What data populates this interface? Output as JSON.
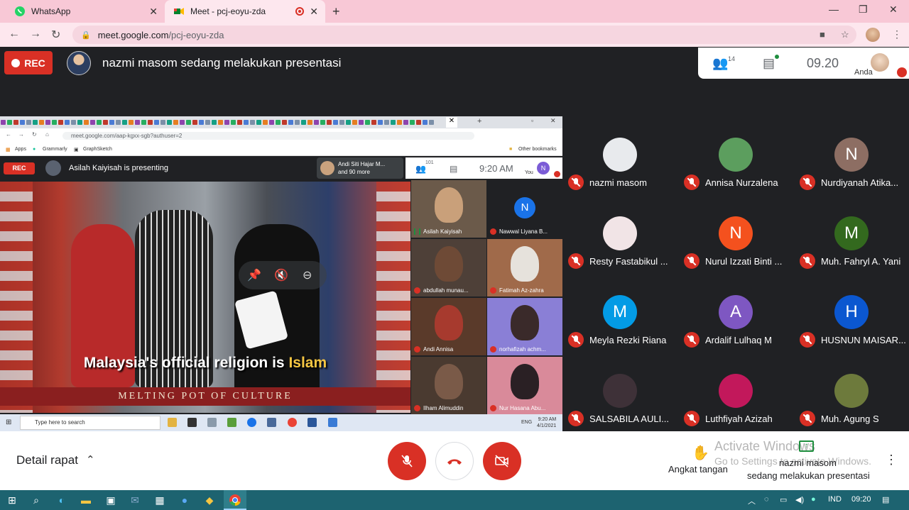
{
  "browser": {
    "tabs": [
      {
        "title": "WhatsApp",
        "icon": "whatsapp-icon"
      },
      {
        "title": "Meet - pcj-eoyu-zda",
        "icon": "google-meet-icon",
        "recording": true
      }
    ],
    "url_host": "meet.google.com",
    "url_path": "/pcj-eoyu-zda"
  },
  "meet": {
    "rec_label": "REC",
    "presenting_text": "nazmi masom sedang melakukan presentasi",
    "participant_count": "14",
    "time": "09.20",
    "self_label": "Anda"
  },
  "shared": {
    "url": "meet.google.com/aap-kgxx-sgb?authuser=2",
    "bookmarks": [
      "Apps",
      "Grammarly",
      "GraphSketch",
      "Other bookmarks"
    ],
    "rec_label": "REC",
    "presenting_text": "Asilah Kaiyisah is presenting",
    "toast_line1": "Andi Siti Hajar M...",
    "toast_line2": "and 90 more",
    "participant_count": "101",
    "time": "9:20 AM",
    "you_label": "You",
    "you_initial": "N",
    "caption_pre": "Malaysia's official religion is ",
    "caption_hl": "Islam",
    "band_text": "MELTING POT OF CULTURE",
    "tiles": [
      {
        "name": "Asilah Kaiyisah"
      },
      {
        "name": "Nawwal Liyana B...",
        "initial": "N"
      },
      {
        "name": "abdullah munau..."
      },
      {
        "name": "Fatimah Az-zahra"
      },
      {
        "name": "Andi Annisa"
      },
      {
        "name": "norhafizah achm..."
      },
      {
        "name": "Ilham Alimuddin"
      },
      {
        "name": "Nur Hasana Abu..."
      }
    ],
    "taskbar_search": "Type here to search",
    "lang": "ENG",
    "clock_time": "9:20 AM",
    "clock_date": "4/1/2021"
  },
  "participants": [
    {
      "name": "nazmi masom",
      "initial": "",
      "color": "#e8eaed"
    },
    {
      "name": "Annisa Nurzalena",
      "initial": "",
      "color": "#5c9e5e"
    },
    {
      "name": "Nurdiyanah Atika...",
      "initial": "N",
      "color": "#8d6e63"
    },
    {
      "name": "Resty Fastabikul ...",
      "initial": "",
      "color": "#f1e4e6"
    },
    {
      "name": "Nurul Izzati Binti ...",
      "initial": "N",
      "color": "#f4511e"
    },
    {
      "name": "Muh. Fahryl A. Yani",
      "initial": "M",
      "color": "#33691e"
    },
    {
      "name": "Meyla Rezki Riana",
      "initial": "M",
      "color": "#039be5"
    },
    {
      "name": "Ardalif Lulhaq M",
      "initial": "A",
      "color": "#7e57c2"
    },
    {
      "name": "HUSNUN MAISAR...",
      "initial": "H",
      "color": "#0b57d0"
    },
    {
      "name": "SALSABILA AULI...",
      "initial": "",
      "color": "#3e3138"
    },
    {
      "name": "Luthfiyah Azizah",
      "initial": "",
      "color": "#c2185b"
    },
    {
      "name": "Muh. Agung S",
      "initial": "",
      "color": "#6d7a3c"
    }
  ],
  "bottom": {
    "detail_label": "Detail rapat",
    "raise_hand": "Angkat tangan",
    "activate_line1": "Activate Windows",
    "activate_line2": "Go to Settings to activate Windows.",
    "present_line1": "nazmi masom",
    "present_line2": "sedang melakukan presentasi"
  },
  "taskbar": {
    "lang": "IND",
    "time": "09:20"
  }
}
